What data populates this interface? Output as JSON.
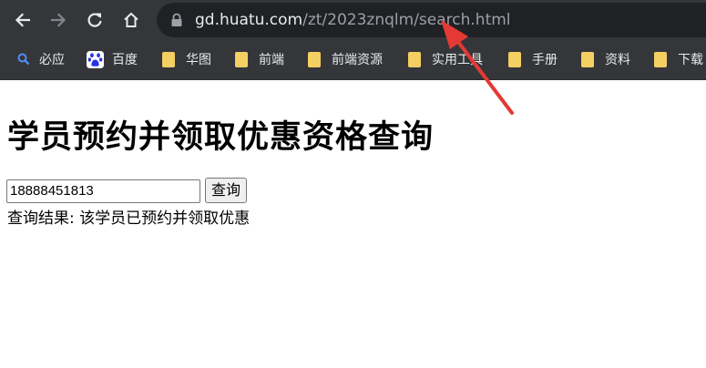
{
  "browser": {
    "url_host": "gd.huatu.com",
    "url_path": "/zt/2023znqlm/search.html"
  },
  "bookmarks": [
    {
      "label": "必应"
    },
    {
      "label": "百度"
    },
    {
      "label": "华图"
    },
    {
      "label": "前端"
    },
    {
      "label": "前端资源"
    },
    {
      "label": "实用工具"
    },
    {
      "label": "手册"
    },
    {
      "label": "资料"
    },
    {
      "label": "下载"
    }
  ],
  "page": {
    "title": "学员预约并领取优惠资格查询",
    "phone_value": "18888451813",
    "query_button": "查询",
    "result_text": "查询结果: 该学员已预约并领取优惠"
  },
  "colors": {
    "toolbar_bg": "#35363a",
    "omnibox_bg": "#202124",
    "folder": "#f4cf62",
    "annotation_arrow": "#e53935"
  }
}
